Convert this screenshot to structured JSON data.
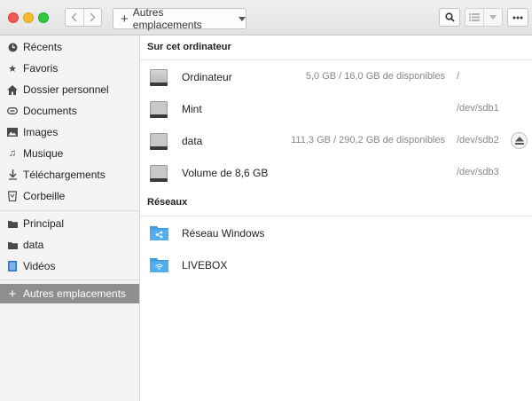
{
  "header": {
    "path_label": "Autres emplacements"
  },
  "sidebar": {
    "items": [
      {
        "label": "Récents",
        "icon": "clock-icon"
      },
      {
        "label": "Favoris",
        "icon": "star-icon"
      },
      {
        "label": "Dossier personnel",
        "icon": "home-icon"
      },
      {
        "label": "Documents",
        "icon": "documents-icon"
      },
      {
        "label": "Images",
        "icon": "image-icon"
      },
      {
        "label": "Musique",
        "icon": "music-icon"
      },
      {
        "label": "Téléchargements",
        "icon": "download-icon"
      },
      {
        "label": "Corbeille",
        "icon": "trash-icon"
      }
    ],
    "bookmarks": [
      {
        "label": "Principal",
        "icon": "folder-icon"
      },
      {
        "label": "data",
        "icon": "folder-icon"
      },
      {
        "label": "Vidéos",
        "icon": "video-icon"
      }
    ],
    "other": {
      "label": "Autres emplacements",
      "icon": "plus-icon"
    }
  },
  "main": {
    "computer_section": "Sur cet ordinateur",
    "drives": [
      {
        "name": "Ordinateur",
        "space": "5,0 GB / 16,0 GB de disponibles",
        "mount": "/",
        "eject": false
      },
      {
        "name": "Mint",
        "space": "",
        "mount": "/dev/sdb1",
        "eject": false
      },
      {
        "name": "data",
        "space": "111,3 GB / 290,2 GB de disponibles",
        "mount": "/dev/sdb2",
        "eject": true
      },
      {
        "name": "Volume de 8,6 GB",
        "space": "",
        "mount": "/dev/sdb3",
        "eject": false
      }
    ],
    "network_section": "Réseaux",
    "networks": [
      {
        "name": "Réseau Windows",
        "icon": "network-share-icon"
      },
      {
        "name": "LIVEBOX",
        "icon": "wifi-folder-icon"
      }
    ]
  },
  "colors": {
    "sidebar_active": "#8e8e8e",
    "folder_blue": "#3d9be0"
  }
}
